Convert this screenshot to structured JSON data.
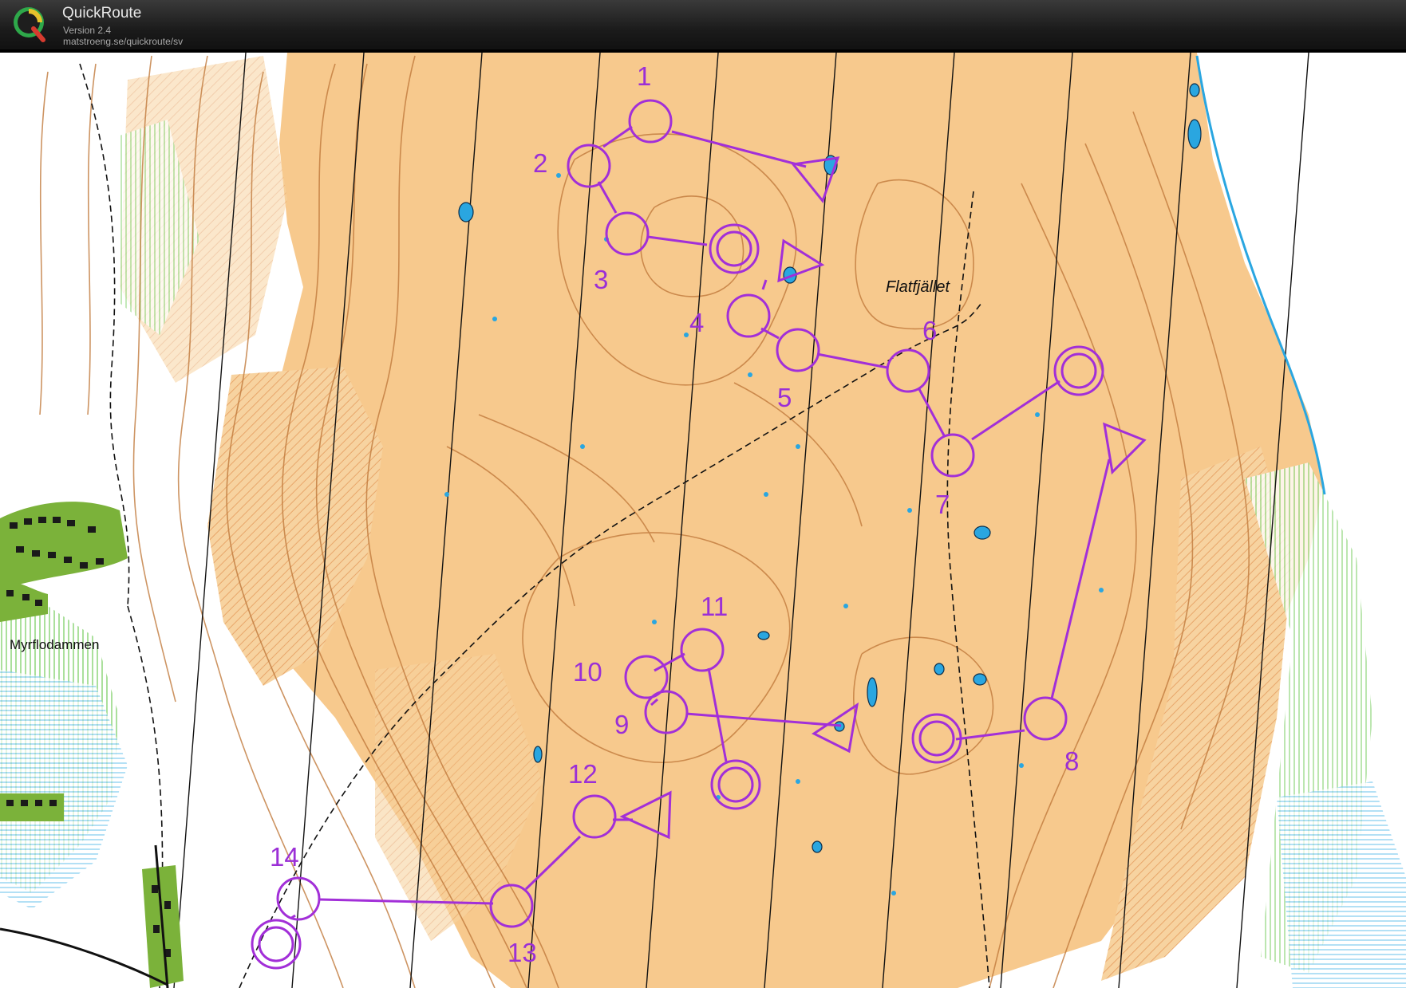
{
  "app": {
    "name": "QuickRoute",
    "version": "Version 2.4",
    "url": "matstroeng.se/quickroute/sv",
    "logo_letter": "Q",
    "logo_icon": "quickroute-logo-icon"
  },
  "map": {
    "place_names": [
      "Flatfjället",
      "Myrflodammen"
    ],
    "controls": [
      "1",
      "2",
      "3",
      "4",
      "5",
      "6",
      "7",
      "8",
      "9",
      "10",
      "11",
      "12",
      "13",
      "14"
    ],
    "colors": {
      "course": "#a22fd8",
      "open_land": "#f5c98a",
      "contour": "#c0773a",
      "water": "#2aa6e0",
      "vegetation": "#7bd063",
      "buildings": "#1a1a1a",
      "magnetic_north_lines": "#111111"
    }
  }
}
